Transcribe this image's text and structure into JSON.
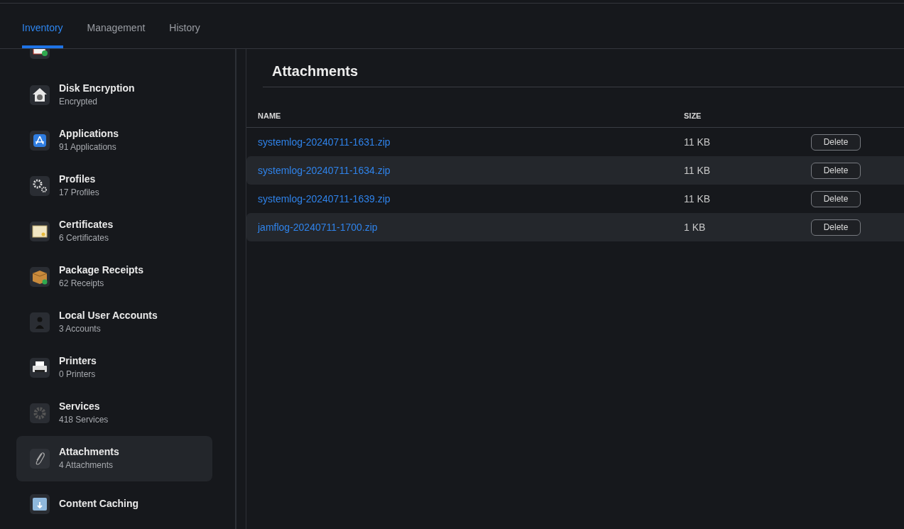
{
  "tabs": [
    {
      "label": "Inventory",
      "selected": true
    },
    {
      "label": "Management",
      "selected": false
    },
    {
      "label": "History",
      "selected": false
    }
  ],
  "sidebar": {
    "items": [
      {
        "title": "Disk Encryption",
        "subtitle": "Encrypted",
        "selected": false
      },
      {
        "title": "Applications",
        "subtitle": "91 Applications",
        "selected": false
      },
      {
        "title": "Profiles",
        "subtitle": "17 Profiles",
        "selected": false
      },
      {
        "title": "Certificates",
        "subtitle": "6 Certificates",
        "selected": false
      },
      {
        "title": "Package Receipts",
        "subtitle": "62 Receipts",
        "selected": false
      },
      {
        "title": "Local User Accounts",
        "subtitle": "3 Accounts",
        "selected": false
      },
      {
        "title": "Printers",
        "subtitle": "0 Printers",
        "selected": false
      },
      {
        "title": "Services",
        "subtitle": "418 Services",
        "selected": false
      },
      {
        "title": "Attachments",
        "subtitle": "4 Attachments",
        "selected": true
      },
      {
        "title": "Content Caching",
        "selected": false
      }
    ]
  },
  "panel": {
    "title": "Attachments",
    "table": {
      "columns": [
        "NAME",
        "SIZE"
      ],
      "rows": [
        {
          "name": "systemlog-20240711-1631.zip",
          "size": "11 KB",
          "action": "Delete"
        },
        {
          "name": "systemlog-20240711-1634.zip",
          "size": "11 KB",
          "action": "Delete"
        },
        {
          "name": "systemlog-20240711-1639.zip",
          "size": "11 KB",
          "action": "Delete"
        },
        {
          "name": "jamflog-20240711-1700.zip",
          "size": "1 KB",
          "action": "Delete"
        }
      ]
    }
  }
}
